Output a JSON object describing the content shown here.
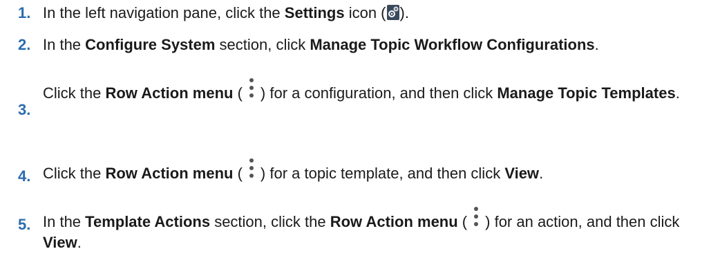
{
  "steps": [
    {
      "number": "1.",
      "t1": "In the left navigation pane, click the ",
      "b1": "Settings",
      "t2": " icon (",
      "icon": "settings-gear-icon",
      "t3": ")."
    },
    {
      "number": "2.",
      "t1": "In the ",
      "b1": "Configure System",
      "t2": " section, click ",
      "b2": "Manage Topic Workflow Configurations",
      "t3": "."
    },
    {
      "number": "3.",
      "t1": "Click the ",
      "b1": "Row Action menu",
      "t2": " (",
      "icon": "row-action-kebab-icon",
      "t3": ") for a configuration, and then click ",
      "b2": "Manage Topic Templates",
      "t4": "."
    },
    {
      "number": "4.",
      "t1": "Click the ",
      "b1": "Row Action menu",
      "t2": " (",
      "icon": "row-action-kebab-icon",
      "t3": ") for a topic template, and then click ",
      "b2": "View",
      "t4": "."
    },
    {
      "number": "5.",
      "t1": "In the ",
      "b1": "Template Actions",
      "t2": " section, click the ",
      "b2": "Row Action menu",
      "t3": " (",
      "icon": "row-action-kebab-icon",
      "t4": ") for an action, and then click ",
      "b3": "View",
      "t5": "."
    }
  ],
  "colors": {
    "step_number": "#2b6cb0",
    "text": "#1a1a1a",
    "settings_icon_bg": "#3a4a5c"
  }
}
